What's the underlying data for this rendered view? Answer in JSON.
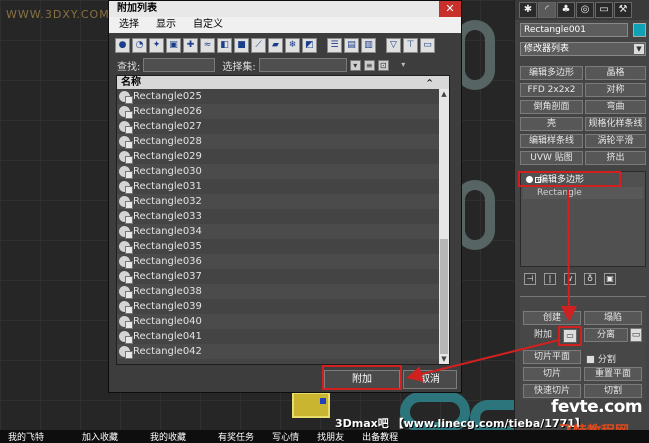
{
  "watermark_top": "WWW.3DXY.COM",
  "dialog": {
    "title": "附加列表",
    "close_label": "✕",
    "menu": [
      "选择",
      "显示",
      "自定义"
    ],
    "filter": {
      "find_label": "查找:",
      "find_value": "",
      "selection_set_label": "选择集:",
      "selection_set_value": ""
    },
    "list_header": "名称",
    "rows": [
      "Rectangle025",
      "Rectangle026",
      "Rectangle027",
      "Rectangle028",
      "Rectangle029",
      "Rectangle030",
      "Rectangle031",
      "Rectangle032",
      "Rectangle033",
      "Rectangle034",
      "Rectangle035",
      "Rectangle036",
      "Rectangle037",
      "Rectangle038",
      "Rectangle039",
      "Rectangle040",
      "Rectangle041",
      "Rectangle042"
    ],
    "attach_button": "附加",
    "cancel_button": "取消"
  },
  "panel": {
    "object_name": "Rectangle001",
    "object_color": "#12a2b6",
    "modifier_list": "修改器列表",
    "modifiers": [
      [
        "编辑多边形",
        "晶格"
      ],
      [
        "FFD 2x2x2",
        "对称"
      ],
      [
        "倒角剖面",
        "弯曲"
      ],
      [
        "壳",
        "规格化样条线"
      ],
      [
        "编辑样条线",
        "涡轮平滑"
      ],
      [
        "UVW 贴图",
        "挤出"
      ]
    ],
    "stack": {
      "item1": "编辑多边形",
      "item2": "Rectangle"
    },
    "rollout": {
      "create": "创建",
      "collapse": "塌陷",
      "attach": "附加",
      "detach": "分离",
      "slice_plane": "切片平面",
      "split": "分割",
      "slice": "切片",
      "reset_plane": "重置平面",
      "quickslice": "快速切片",
      "cut": "切割"
    }
  },
  "caption": "3Dmax吧 【www.linecg.com/tieba/1771】",
  "taskbar": [
    "我的飞特",
    "加入收藏",
    "我的收藏",
    "有奖任务",
    "写心情",
    "找朋友",
    "出备教程"
  ],
  "logo": {
    "line1": "fevte.com",
    "line2": "飞特教程网"
  },
  "highlight_color": "#d02020"
}
